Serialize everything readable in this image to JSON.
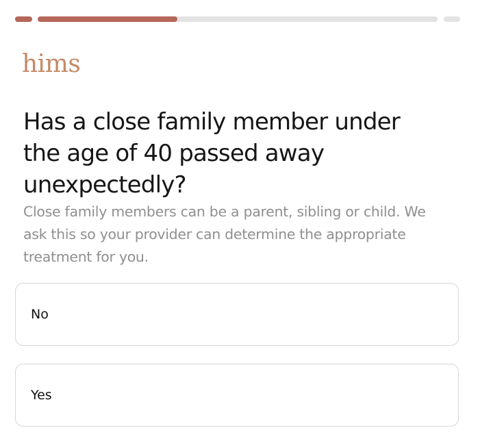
{
  "progress": {
    "segments": [
      {
        "fill": 1.0
      },
      {
        "fill": 0.35
      },
      {
        "fill": 0.0
      }
    ],
    "fill_color": "#b5675a",
    "track_color": "#e3e3e3"
  },
  "brand": {
    "logo_text": "hims",
    "logo_color": "#c58a67"
  },
  "question": {
    "title": "Has a close family member under the age of 40 passed away unexpectedly?",
    "helper": "Close family members can be a parent, sibling or child. We ask this so your provider can determine the appropriate treatment for you."
  },
  "options": [
    {
      "label": "No"
    },
    {
      "label": "Yes"
    }
  ]
}
